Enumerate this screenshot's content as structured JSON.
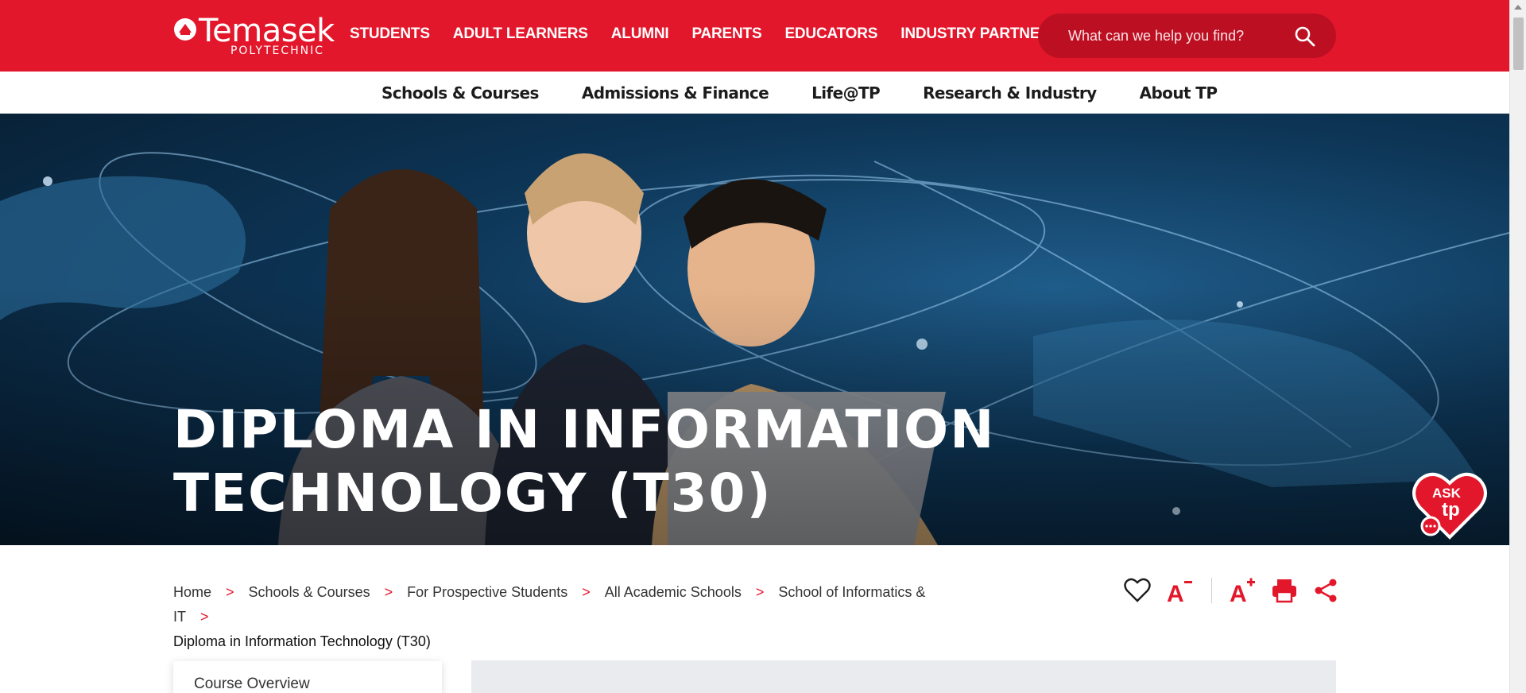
{
  "header": {
    "logo": {
      "name": "Temasek",
      "sub": "POLYTECHNIC"
    },
    "nav": [
      {
        "label": "STUDENTS"
      },
      {
        "label": "ADULT LEARNERS"
      },
      {
        "label": "ALUMNI"
      },
      {
        "label": "PARENTS"
      },
      {
        "label": "EDUCATORS"
      },
      {
        "label": "INDUSTRY PARTNERS"
      }
    ],
    "search": {
      "placeholder": "What can we help you find?",
      "icon": "search-icon"
    }
  },
  "subnav": [
    {
      "label": "Schools & Courses"
    },
    {
      "label": "Admissions & Finance"
    },
    {
      "label": "Life@TP"
    },
    {
      "label": "Research & Industry"
    },
    {
      "label": "About TP"
    }
  ],
  "hero": {
    "title": "Diploma in Information Technology (T30)"
  },
  "ask_widget": {
    "line1": "ASK",
    "line2": "tp"
  },
  "breadcrumb": {
    "items": [
      {
        "label": "Home"
      },
      {
        "label": "Schools & Courses"
      },
      {
        "label": "For Prospective Students"
      },
      {
        "label": "All Academic Schools"
      },
      {
        "label": "School of Informatics & IT"
      }
    ],
    "separator": ">",
    "current": "Diploma in Information Technology (T30)"
  },
  "tools": [
    {
      "name": "favourite-heart-icon"
    },
    {
      "name": "decrease-font-icon"
    },
    {
      "name": "increase-font-icon"
    },
    {
      "name": "print-icon"
    },
    {
      "name": "share-icon"
    }
  ],
  "sidebar": {
    "items": [
      {
        "label": "Course Overview"
      }
    ]
  },
  "colors": {
    "brand_red": "#e3172b",
    "search_bg": "#bd0f22",
    "text_dark": "#1c1c1c"
  }
}
